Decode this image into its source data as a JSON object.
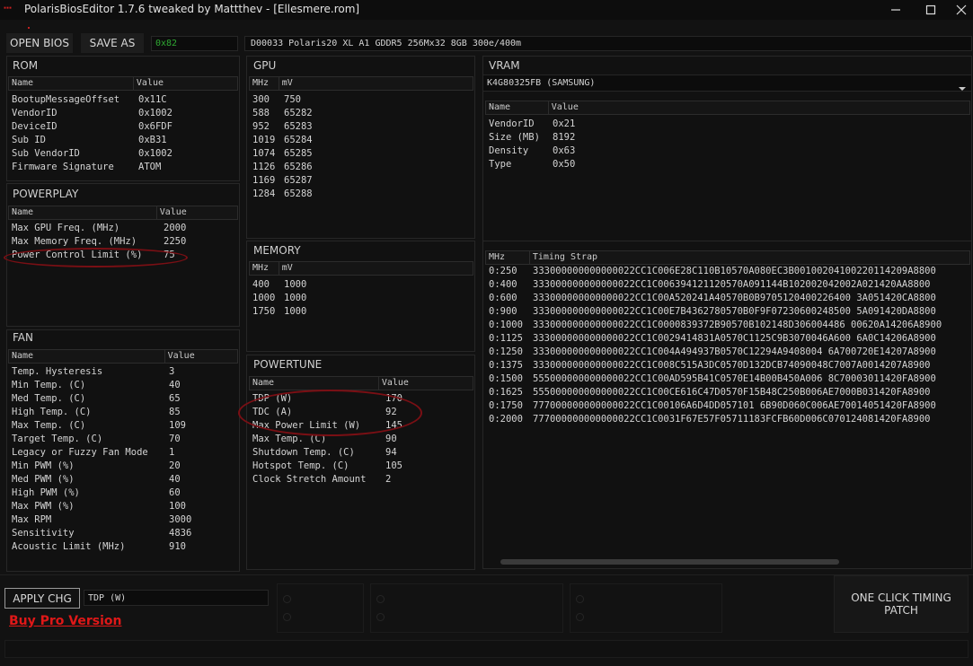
{
  "window": {
    "title": "PolarisBiosEditor 1.7.6 tweaked by Mattthev  - [Ellesmere.rom]"
  },
  "toolbar": {
    "open_bios": "OPEN BIOS",
    "save_as": "SAVE AS",
    "checksum": "0x82",
    "bios_info": "D00033 Polaris20 XL A1 GDDR5 256Mx32 8GB 300e/400m"
  },
  "rom": {
    "title": "ROM",
    "headers": [
      "Name",
      "Value"
    ],
    "rows": [
      [
        "BootupMessageOffset",
        "0x11C"
      ],
      [
        "VendorID",
        "0x1002"
      ],
      [
        "DeviceID",
        "0x6FDF"
      ],
      [
        "Sub ID",
        "0xB31"
      ],
      [
        "Sub VendorID",
        "0x1002"
      ],
      [
        "Firmware Signature",
        "ATOM"
      ]
    ]
  },
  "powerplay": {
    "title": "POWERPLAY",
    "headers": [
      "Name",
      "Value"
    ],
    "rows": [
      [
        "Max GPU Freq. (MHz)",
        "2000"
      ],
      [
        "Max Memory Freq. (MHz)",
        "2250"
      ],
      [
        "Power Control Limit (%)",
        "75"
      ]
    ]
  },
  "fan": {
    "title": "FAN",
    "headers": [
      "Name",
      "Value"
    ],
    "rows": [
      [
        "Temp. Hysteresis",
        "3"
      ],
      [
        "Min Temp. (C)",
        "40"
      ],
      [
        "Med Temp. (C)",
        "65"
      ],
      [
        "High Temp. (C)",
        "85"
      ],
      [
        "Max Temp. (C)",
        "109"
      ],
      [
        "Target Temp. (C)",
        "70"
      ],
      [
        "Legacy or Fuzzy Fan Mode",
        "1"
      ],
      [
        "Min PWM (%)",
        "20"
      ],
      [
        "Med PWM (%)",
        "40"
      ],
      [
        "High PWM (%)",
        "60"
      ],
      [
        "Max PWM (%)",
        "100"
      ],
      [
        "Max RPM",
        "3000"
      ],
      [
        "Sensitivity",
        "4836"
      ],
      [
        "Acoustic Limit (MHz)",
        "910"
      ]
    ]
  },
  "gpu": {
    "title": "GPU",
    "headers": [
      "MHz",
      "mV"
    ],
    "rows": [
      [
        "300",
        "750"
      ],
      [
        "588",
        "65282"
      ],
      [
        "952",
        "65283"
      ],
      [
        "1019",
        "65284"
      ],
      [
        "1074",
        "65285"
      ],
      [
        "1126",
        "65286"
      ],
      [
        "1169",
        "65287"
      ],
      [
        "1284",
        "65288"
      ]
    ]
  },
  "memory": {
    "title": "MEMORY",
    "headers": [
      "MHz",
      "mV"
    ],
    "rows": [
      [
        "400",
        "1000"
      ],
      [
        "1000",
        "1000"
      ],
      [
        "1750",
        "1000"
      ]
    ]
  },
  "powertune": {
    "title": "POWERTUNE",
    "headers": [
      "Name",
      "Value"
    ],
    "rows": [
      [
        "TDP (W)",
        "170"
      ],
      [
        "TDC (A)",
        "92"
      ],
      [
        "Max Power Limit (W)",
        "145"
      ],
      [
        "Max Temp. (C)",
        "90"
      ],
      [
        "Shutdown Temp. (C)",
        "94"
      ],
      [
        "Hotspot Temp. (C)",
        "105"
      ],
      [
        "Clock Stretch Amount",
        "2"
      ]
    ]
  },
  "vram": {
    "title": "VRAM",
    "selected": "K4G80325FB (SAMSUNG)",
    "headers": [
      "Name",
      "Value"
    ],
    "rows": [
      [
        "VendorID",
        "0x21"
      ],
      [
        "Size (MB)",
        "8192"
      ],
      [
        "Density",
        "0x63"
      ],
      [
        "Type",
        "0x50"
      ]
    ],
    "timing_headers": [
      "MHz",
      "Timing Strap"
    ],
    "timings": [
      [
        "0:250",
        "333000000000000022CC1C006E28C110B10570A080EC3B00100204100220114209A8800"
      ],
      [
        "0:400",
        "333000000000000022CC1C006394121120570A091144B102002042002A021420AA8800"
      ],
      [
        "0:600",
        "333000000000000022CC1C00A520241A40570B0B9705120400226400 3A051420CA8800"
      ],
      [
        "0:900",
        "333000000000000022CC1C00E7B4362780570B0F9F07230600248500 5A091420DA8800"
      ],
      [
        "0:1000",
        "333000000000000022CC1C0000839372B90570B102148D306004486 00620A14206A8900"
      ],
      [
        "0:1125",
        "333000000000000022CC1C0029414831A0570C1125C9B3070046A600 6A0C14206A8900"
      ],
      [
        "0:1250",
        "333000000000000022CC1C004A494937B0570C12294A9408004 6A700720E14207A8900"
      ],
      [
        "0:1375",
        "333000000000000022CC1C008C515A3DC0570D132DCB74090048C7007A0014207A8900"
      ],
      [
        "0:1500",
        "555000000000000022CC1C00AD595B41C0570E14B00B450A006 8C70003011420FA8900"
      ],
      [
        "0:1625",
        "555000000000000022CC1C00CE616C47D0570F15B48C250B006AE7000B031420FA8900"
      ],
      [
        "0:1750",
        "777000000000000022CC1C00106A6D4DD057101 6B90D060C006AE70014051420FA8900"
      ],
      [
        "0:2000",
        "777000000000000022CC1C0031F67E57F05711183FCFB60D006C070124081420FA8900"
      ]
    ]
  },
  "bottom": {
    "apply": "APPLY CHG",
    "selected_field": "TDP (W)",
    "buy_pro": "Buy Pro Version",
    "one_click": "ONE CLICK TIMING PATCH"
  }
}
